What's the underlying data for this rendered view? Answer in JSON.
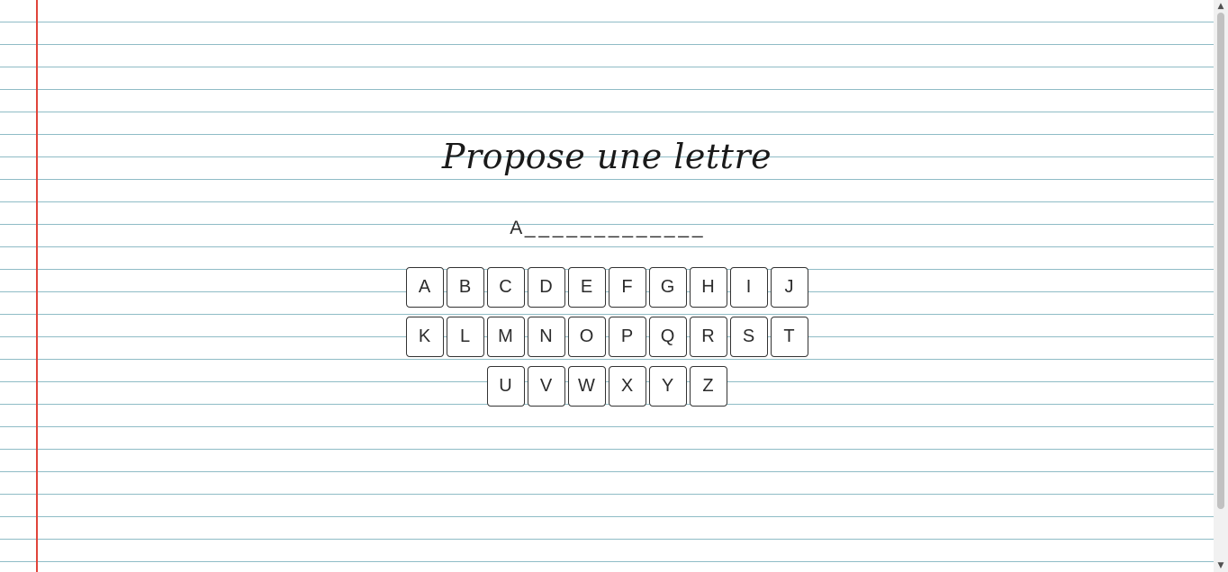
{
  "title": "Propose une lettre",
  "word": {
    "letters": [
      "A",
      "_",
      "_",
      "_",
      "_",
      "_",
      "_",
      "_",
      "_",
      "_",
      "_",
      "_",
      "_",
      "_",
      "_",
      "_",
      "_",
      "_",
      "_",
      "_",
      "_",
      "_",
      "_",
      "_",
      "_"
    ]
  },
  "keyboard": {
    "rows": [
      [
        "A",
        "B",
        "C",
        "D",
        "E",
        "F",
        "G",
        "H",
        "I",
        "J"
      ],
      [
        "K",
        "L",
        "M",
        "N",
        "O",
        "P",
        "Q",
        "R",
        "S",
        "T"
      ],
      [
        "U",
        "V",
        "W",
        "X",
        "Y",
        "Z"
      ]
    ]
  },
  "icons": {
    "scroll_up": "chevron-up-icon",
    "scroll_down": "chevron-down-icon"
  },
  "colors": {
    "margin_line": "#e0443a",
    "ruled_line": "#8fbcc6"
  }
}
